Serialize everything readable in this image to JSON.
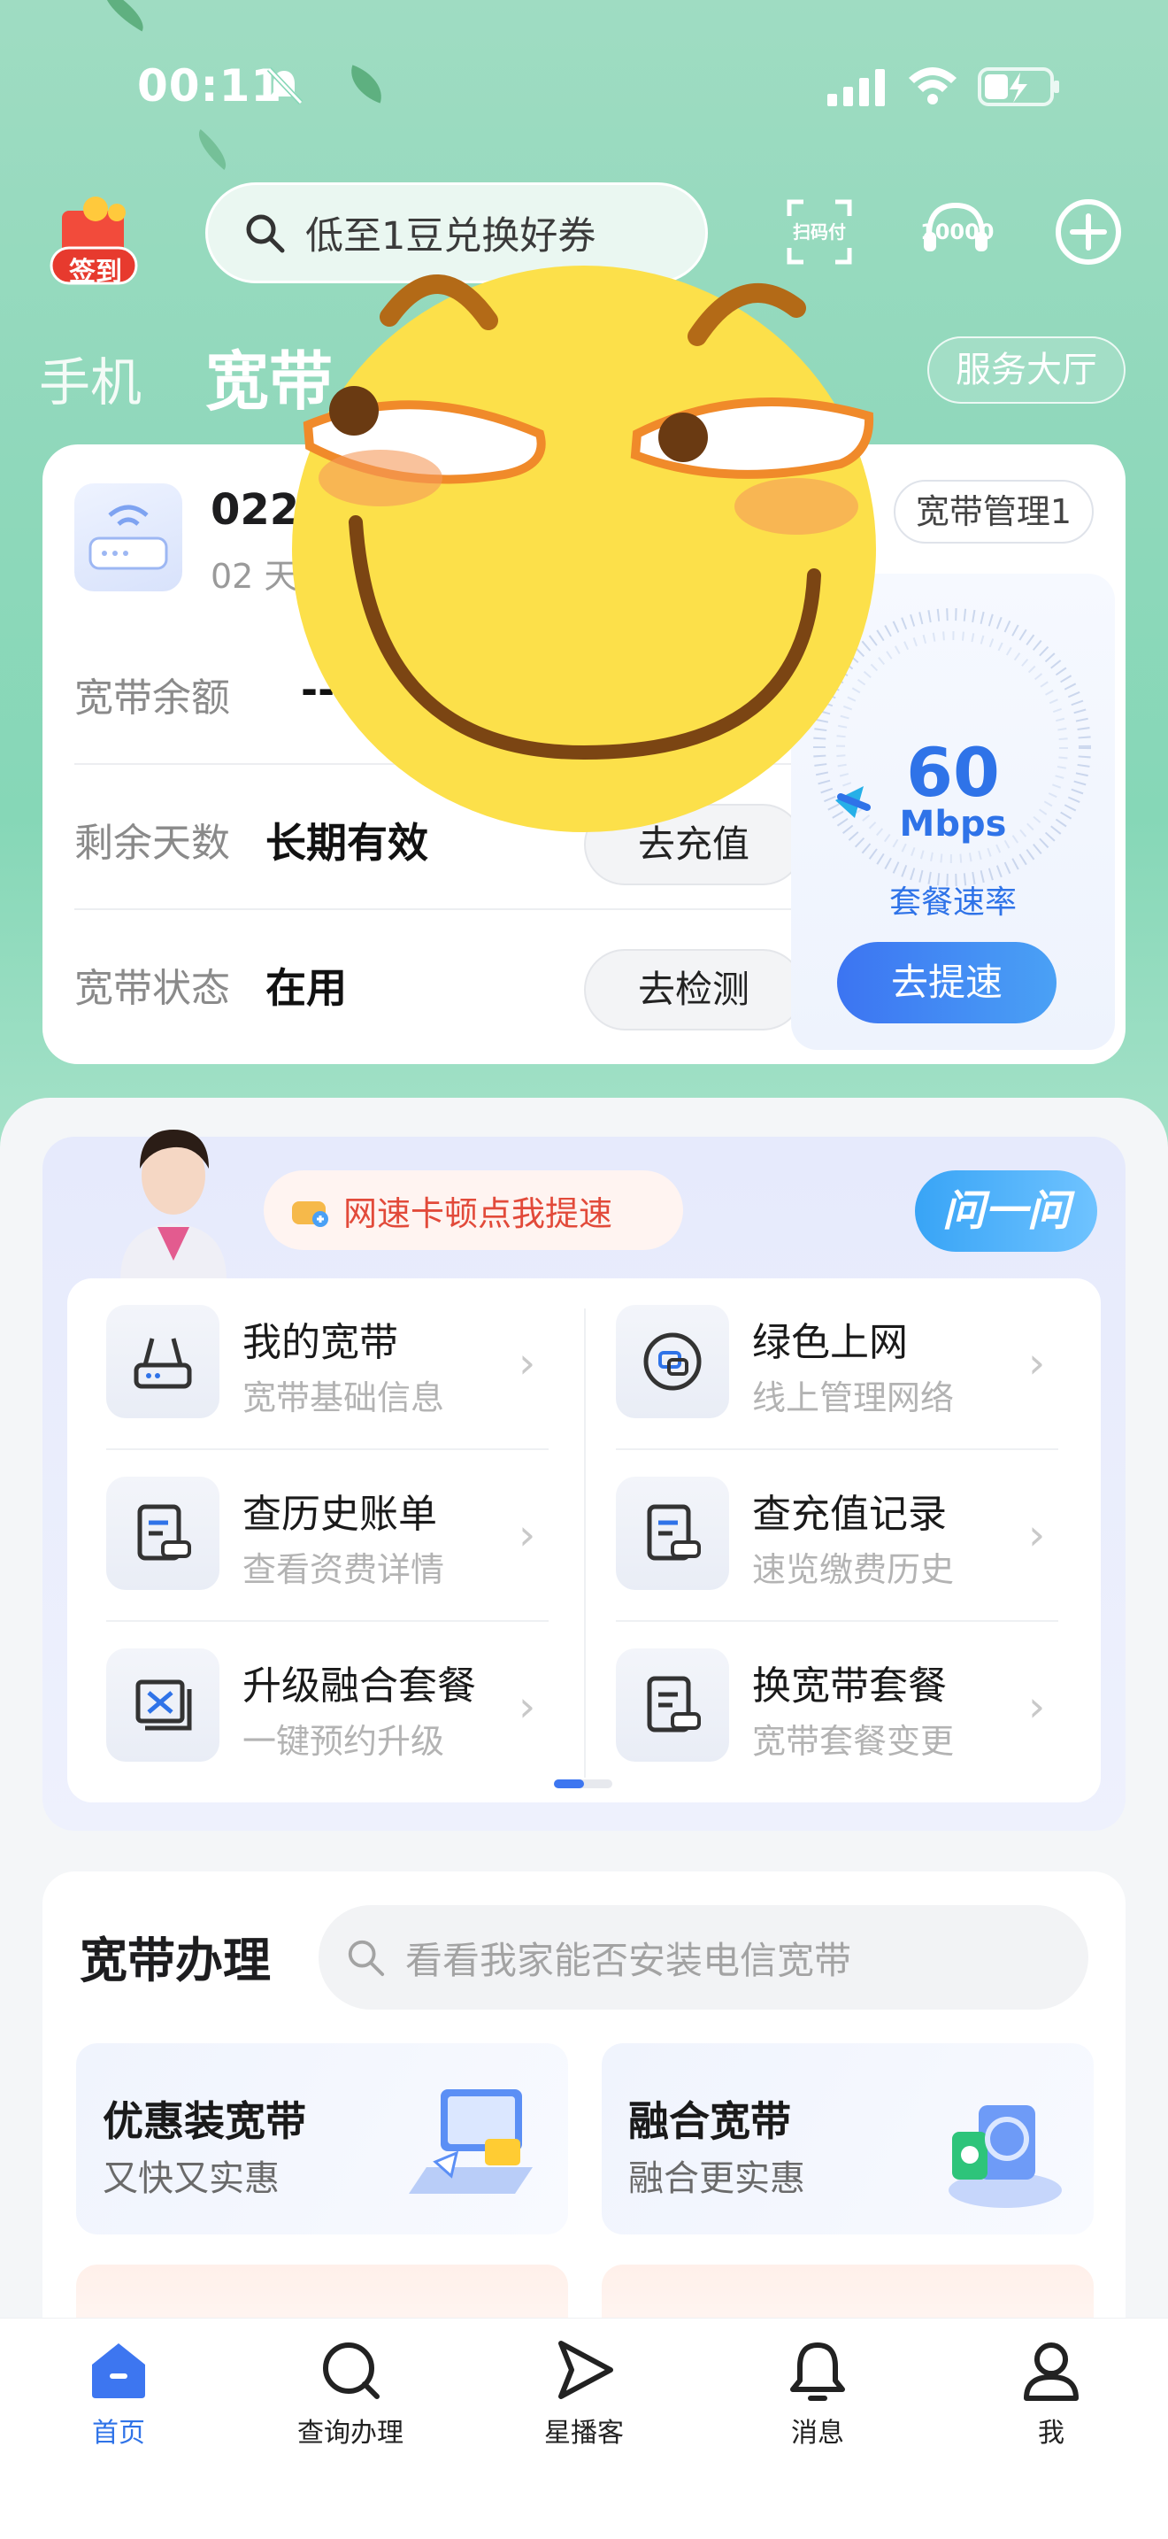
{
  "status_bar": {
    "time": "00:11"
  },
  "header": {
    "checkin_label": "签到",
    "search_placeholder": "低至1豆兑换好券",
    "scan_pay_label": "扫码付",
    "hotline_label": "10000"
  },
  "tabs": [
    {
      "label": "手机",
      "active": false
    },
    {
      "label": "宽带",
      "active": true
    }
  ],
  "service_hall_label": "服务大厅",
  "account": {
    "number_partial": "0227",
    "sub_partial": "02 天",
    "manage_label": "宽带管理1",
    "rows": [
      {
        "label": "宽带余额",
        "value": "--",
        "button": ""
      },
      {
        "label": "剩余天数",
        "value": "长期有效",
        "button": "去充值"
      },
      {
        "label": "宽带状态",
        "value": "在用",
        "button": "去检测"
      }
    ],
    "speed": {
      "value": "60",
      "unit": "Mbps",
      "label": "套餐速率",
      "button": "去提速"
    }
  },
  "assistant": {
    "bubble_text": "网速卡顿点我提速",
    "ask_label": "问一问"
  },
  "services": [
    {
      "title": "我的宽带",
      "subtitle": "宽带基础信息",
      "icon": "router-icon"
    },
    {
      "title": "绿色上网",
      "subtitle": "线上管理网络",
      "icon": "green-net-icon"
    },
    {
      "title": "查历史账单",
      "subtitle": "查看资费详情",
      "icon": "bill-icon"
    },
    {
      "title": "查充值记录",
      "subtitle": "速览缴费历史",
      "icon": "recharge-record-icon"
    },
    {
      "title": "升级融合套餐",
      "subtitle": "一键预约升级",
      "icon": "upgrade-icon"
    },
    {
      "title": "换宽带套餐",
      "subtitle": "宽带套餐变更",
      "icon": "change-plan-icon"
    }
  ],
  "business": {
    "title": "宽带办理",
    "search_placeholder": "看看我家能否安装电信宽带",
    "offers": [
      {
        "title": "优惠装宽带",
        "subtitle": "又快又实惠"
      },
      {
        "title": "融合宽带",
        "subtitle": "融合更实惠"
      }
    ]
  },
  "bottom_nav": [
    {
      "label": "首页",
      "active": true,
      "icon": "home-icon"
    },
    {
      "label": "查询办理",
      "active": false,
      "icon": "query-icon"
    },
    {
      "label": "星播客",
      "active": false,
      "icon": "star-broadcast-icon"
    },
    {
      "label": "消息",
      "active": false,
      "icon": "bell-icon"
    },
    {
      "label": "我",
      "active": false,
      "icon": "user-icon"
    }
  ],
  "colors": {
    "accent": "#2f73e8",
    "brand_green": "#86d7b7",
    "alert_red": "#e24a3a"
  }
}
